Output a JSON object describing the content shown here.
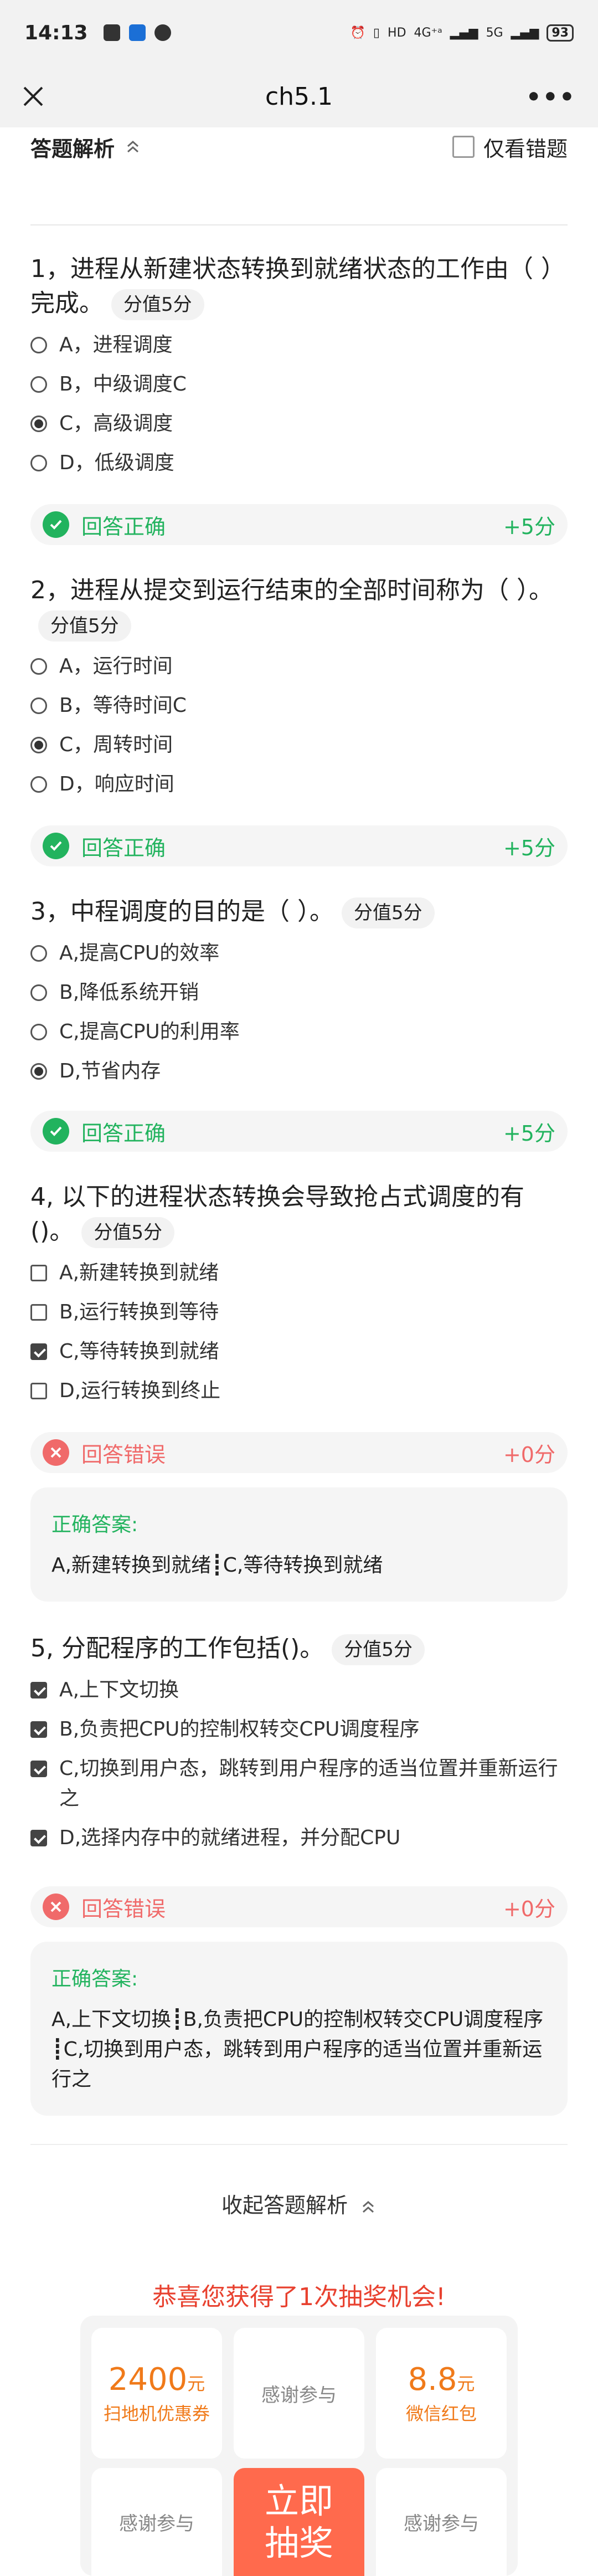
{
  "status_bar": {
    "time": "14:13",
    "network_1": "4G⁺ᵃ",
    "network_2": "5G",
    "battery": "93"
  },
  "navbar": {
    "title": "ch5.1"
  },
  "analysis": {
    "title": "答题解析",
    "wrong_only_label": "仅看错题"
  },
  "questions": [
    {
      "title": "1，进程从新建状态转换到就绪状态的工作由（ ）完成。",
      "score": "分值5分",
      "options": [
        "A，进程调度",
        "B，中级调度C",
        "C，高级调度",
        "D，低级调度"
      ],
      "selected": [
        2
      ],
      "result": "回答正确",
      "points": "+5分"
    },
    {
      "title": "2，进程从提交到运行结束的全部时间称为（ ）。",
      "score": "分值5分",
      "options": [
        "A，运行时间",
        "B，等待时间C",
        "C，周转时间",
        "D，响应时间"
      ],
      "selected": [
        2
      ],
      "result": "回答正确",
      "points": "+5分"
    },
    {
      "title": "3，中程调度的目的是（ ）。",
      "score": "分值5分",
      "options": [
        "A,提高CPU的效率",
        "B,降低系统开销",
        "C,提高CPU的利用率",
        "D,节省内存"
      ],
      "selected": [
        3
      ],
      "result": "回答正确",
      "points": "+5分"
    },
    {
      "title": "4, 以下的进程状态转换会导致抢占式调度的有()。",
      "score": "分值5分",
      "options": [
        "A,新建转换到就绪",
        "B,运行转换到等待",
        "C,等待转换到就绪",
        "D,运行转换到终止"
      ],
      "selected": [
        2
      ],
      "result": "回答错误",
      "points": "+0分",
      "answer_label": "正确答案:",
      "answer": "A,新建转换到就绪┋C,等待转换到就绪"
    },
    {
      "title": "5, 分配程序的工作包括()。",
      "score": "分值5分",
      "options": [
        "A,上下文切换",
        "B,负责把CPU的控制权转交CPU调度程序",
        "C,切换到用户态，跳转到用户程序的适当位置并重新运行之",
        "D,选择内存中的就绪进程，并分配CPU"
      ],
      "selected": [
        0,
        1,
        2,
        3
      ],
      "result": "回答错误",
      "points": "+0分",
      "answer_label": "正确答案:",
      "answer": "A,上下文切换┋B,负责把CPU的控制权转交CPU调度程序┋C,切换到用户态，跳转到用户程序的适当位置并重新运行之"
    }
  ],
  "collapse_label": "收起答题解析",
  "lottery": {
    "title": "恭喜您获得了1次抽奖机会!",
    "prize1": {
      "amount": "2400",
      "unit": "元",
      "desc": "扫地机优惠券"
    },
    "thanks": "感谢参与",
    "prize2": {
      "amount": "8.8",
      "unit": "元",
      "desc": "微信红包"
    },
    "draw_label": "立即抽奖"
  },
  "colors": {
    "correct": "#22b35e",
    "wrong": "#f06a6a",
    "lottery_red": "#e8412f",
    "prize_orange": "#f07a1a"
  }
}
